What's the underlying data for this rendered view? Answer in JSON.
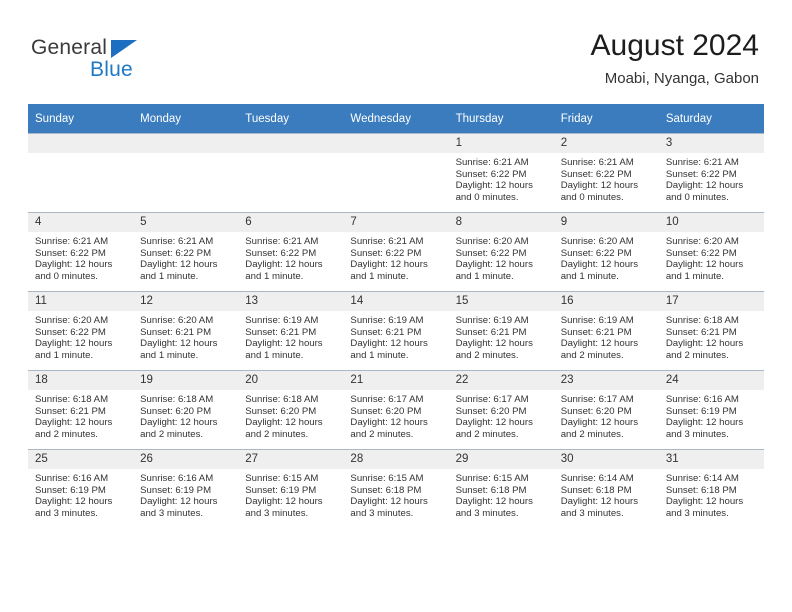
{
  "brand": {
    "name_top": "General",
    "name_bottom": "Blue",
    "triangle_color": "#1c6fc0",
    "blue_color": "#2079c7"
  },
  "header": {
    "title": "August 2024",
    "subtitle": "Moabi, Nyanga, Gabon"
  },
  "theme": {
    "header_row_bg": "#3a7cbe",
    "daynum_bg": "#efefef",
    "grid_line": "#a9b8c6"
  },
  "weekday_headers": [
    "Sunday",
    "Monday",
    "Tuesday",
    "Wednesday",
    "Thursday",
    "Friday",
    "Saturday"
  ],
  "labels": {
    "sunrise_prefix": "Sunrise:",
    "sunset_prefix": "Sunset:",
    "daylight_prefix": "Daylight:"
  },
  "weeks": [
    [
      {
        "day": "",
        "empty": true
      },
      {
        "day": "",
        "empty": true
      },
      {
        "day": "",
        "empty": true
      },
      {
        "day": "",
        "empty": true
      },
      {
        "day": "1",
        "sunrise": "Sunrise: 6:21 AM",
        "sunset": "Sunset: 6:22 PM",
        "daylight_line1": "Daylight: 12 hours",
        "daylight_line2": "and 0 minutes."
      },
      {
        "day": "2",
        "sunrise": "Sunrise: 6:21 AM",
        "sunset": "Sunset: 6:22 PM",
        "daylight_line1": "Daylight: 12 hours",
        "daylight_line2": "and 0 minutes."
      },
      {
        "day": "3",
        "sunrise": "Sunrise: 6:21 AM",
        "sunset": "Sunset: 6:22 PM",
        "daylight_line1": "Daylight: 12 hours",
        "daylight_line2": "and 0 minutes."
      }
    ],
    [
      {
        "day": "4",
        "sunrise": "Sunrise: 6:21 AM",
        "sunset": "Sunset: 6:22 PM",
        "daylight_line1": "Daylight: 12 hours",
        "daylight_line2": "and 0 minutes."
      },
      {
        "day": "5",
        "sunrise": "Sunrise: 6:21 AM",
        "sunset": "Sunset: 6:22 PM",
        "daylight_line1": "Daylight: 12 hours",
        "daylight_line2": "and 1 minute."
      },
      {
        "day": "6",
        "sunrise": "Sunrise: 6:21 AM",
        "sunset": "Sunset: 6:22 PM",
        "daylight_line1": "Daylight: 12 hours",
        "daylight_line2": "and 1 minute."
      },
      {
        "day": "7",
        "sunrise": "Sunrise: 6:21 AM",
        "sunset": "Sunset: 6:22 PM",
        "daylight_line1": "Daylight: 12 hours",
        "daylight_line2": "and 1 minute."
      },
      {
        "day": "8",
        "sunrise": "Sunrise: 6:20 AM",
        "sunset": "Sunset: 6:22 PM",
        "daylight_line1": "Daylight: 12 hours",
        "daylight_line2": "and 1 minute."
      },
      {
        "day": "9",
        "sunrise": "Sunrise: 6:20 AM",
        "sunset": "Sunset: 6:22 PM",
        "daylight_line1": "Daylight: 12 hours",
        "daylight_line2": "and 1 minute."
      },
      {
        "day": "10",
        "sunrise": "Sunrise: 6:20 AM",
        "sunset": "Sunset: 6:22 PM",
        "daylight_line1": "Daylight: 12 hours",
        "daylight_line2": "and 1 minute."
      }
    ],
    [
      {
        "day": "11",
        "sunrise": "Sunrise: 6:20 AM",
        "sunset": "Sunset: 6:22 PM",
        "daylight_line1": "Daylight: 12 hours",
        "daylight_line2": "and 1 minute."
      },
      {
        "day": "12",
        "sunrise": "Sunrise: 6:20 AM",
        "sunset": "Sunset: 6:21 PM",
        "daylight_line1": "Daylight: 12 hours",
        "daylight_line2": "and 1 minute."
      },
      {
        "day": "13",
        "sunrise": "Sunrise: 6:19 AM",
        "sunset": "Sunset: 6:21 PM",
        "daylight_line1": "Daylight: 12 hours",
        "daylight_line2": "and 1 minute."
      },
      {
        "day": "14",
        "sunrise": "Sunrise: 6:19 AM",
        "sunset": "Sunset: 6:21 PM",
        "daylight_line1": "Daylight: 12 hours",
        "daylight_line2": "and 1 minute."
      },
      {
        "day": "15",
        "sunrise": "Sunrise: 6:19 AM",
        "sunset": "Sunset: 6:21 PM",
        "daylight_line1": "Daylight: 12 hours",
        "daylight_line2": "and 2 minutes."
      },
      {
        "day": "16",
        "sunrise": "Sunrise: 6:19 AM",
        "sunset": "Sunset: 6:21 PM",
        "daylight_line1": "Daylight: 12 hours",
        "daylight_line2": "and 2 minutes."
      },
      {
        "day": "17",
        "sunrise": "Sunrise: 6:18 AM",
        "sunset": "Sunset: 6:21 PM",
        "daylight_line1": "Daylight: 12 hours",
        "daylight_line2": "and 2 minutes."
      }
    ],
    [
      {
        "day": "18",
        "sunrise": "Sunrise: 6:18 AM",
        "sunset": "Sunset: 6:21 PM",
        "daylight_line1": "Daylight: 12 hours",
        "daylight_line2": "and 2 minutes."
      },
      {
        "day": "19",
        "sunrise": "Sunrise: 6:18 AM",
        "sunset": "Sunset: 6:20 PM",
        "daylight_line1": "Daylight: 12 hours",
        "daylight_line2": "and 2 minutes."
      },
      {
        "day": "20",
        "sunrise": "Sunrise: 6:18 AM",
        "sunset": "Sunset: 6:20 PM",
        "daylight_line1": "Daylight: 12 hours",
        "daylight_line2": "and 2 minutes."
      },
      {
        "day": "21",
        "sunrise": "Sunrise: 6:17 AM",
        "sunset": "Sunset: 6:20 PM",
        "daylight_line1": "Daylight: 12 hours",
        "daylight_line2": "and 2 minutes."
      },
      {
        "day": "22",
        "sunrise": "Sunrise: 6:17 AM",
        "sunset": "Sunset: 6:20 PM",
        "daylight_line1": "Daylight: 12 hours",
        "daylight_line2": "and 2 minutes."
      },
      {
        "day": "23",
        "sunrise": "Sunrise: 6:17 AM",
        "sunset": "Sunset: 6:20 PM",
        "daylight_line1": "Daylight: 12 hours",
        "daylight_line2": "and 2 minutes."
      },
      {
        "day": "24",
        "sunrise": "Sunrise: 6:16 AM",
        "sunset": "Sunset: 6:19 PM",
        "daylight_line1": "Daylight: 12 hours",
        "daylight_line2": "and 3 minutes."
      }
    ],
    [
      {
        "day": "25",
        "sunrise": "Sunrise: 6:16 AM",
        "sunset": "Sunset: 6:19 PM",
        "daylight_line1": "Daylight: 12 hours",
        "daylight_line2": "and 3 minutes."
      },
      {
        "day": "26",
        "sunrise": "Sunrise: 6:16 AM",
        "sunset": "Sunset: 6:19 PM",
        "daylight_line1": "Daylight: 12 hours",
        "daylight_line2": "and 3 minutes."
      },
      {
        "day": "27",
        "sunrise": "Sunrise: 6:15 AM",
        "sunset": "Sunset: 6:19 PM",
        "daylight_line1": "Daylight: 12 hours",
        "daylight_line2": "and 3 minutes."
      },
      {
        "day": "28",
        "sunrise": "Sunrise: 6:15 AM",
        "sunset": "Sunset: 6:18 PM",
        "daylight_line1": "Daylight: 12 hours",
        "daylight_line2": "and 3 minutes."
      },
      {
        "day": "29",
        "sunrise": "Sunrise: 6:15 AM",
        "sunset": "Sunset: 6:18 PM",
        "daylight_line1": "Daylight: 12 hours",
        "daylight_line2": "and 3 minutes."
      },
      {
        "day": "30",
        "sunrise": "Sunrise: 6:14 AM",
        "sunset": "Sunset: 6:18 PM",
        "daylight_line1": "Daylight: 12 hours",
        "daylight_line2": "and 3 minutes."
      },
      {
        "day": "31",
        "sunrise": "Sunrise: 6:14 AM",
        "sunset": "Sunset: 6:18 PM",
        "daylight_line1": "Daylight: 12 hours",
        "daylight_line2": "and 3 minutes."
      }
    ]
  ]
}
